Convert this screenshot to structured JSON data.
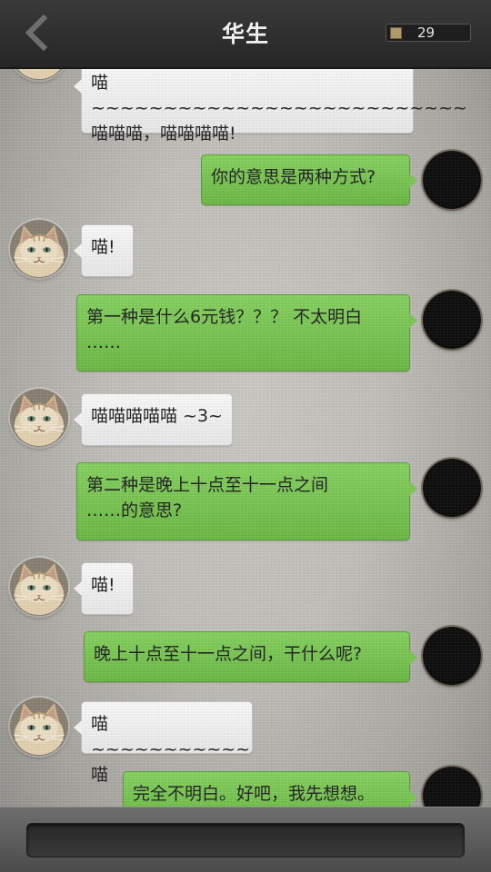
{
  "header": {
    "title": "华生",
    "counter": "29"
  },
  "messages": [
    {
      "from": "other",
      "text": "喵~~~~~~~~~~~~~~~~~~~~~~~~~~\n喵喵喵，喵喵喵喵!"
    },
    {
      "from": "self",
      "text": "你的意思是两种方式?"
    },
    {
      "from": "other",
      "text": "喵!"
    },
    {
      "from": "self",
      "text": "第一种是什么6元钱？？？ 不太明白\n……"
    },
    {
      "from": "other",
      "text": "喵喵喵喵喵 ~3~"
    },
    {
      "from": "self",
      "text": "第二种是晚上十点至十一点之间\n……的意思?"
    },
    {
      "from": "other",
      "text": "喵!"
    },
    {
      "from": "self",
      "text": "晚上十点至十一点之间，干什么呢?"
    },
    {
      "from": "other",
      "text": "喵~~~~~~~~~~~喵"
    },
    {
      "from": "self",
      "text": "完全不明白。好吧，我先想想。"
    }
  ],
  "input": {
    "value": ""
  },
  "colors": {
    "header_bg": "#2e2e2e",
    "outgoing_bubble": "#7cc955",
    "incoming_bubble": "#f6f6f6",
    "bottom_bar": "#5a5a5a"
  },
  "icons": {
    "back": "chevron-left-icon",
    "counter": "coin-icon"
  }
}
